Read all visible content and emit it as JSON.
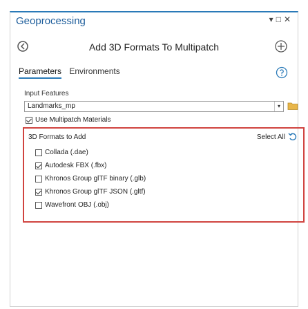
{
  "window": {
    "title": "Geoprocessing",
    "controls": [
      "▾",
      "□",
      "✕"
    ]
  },
  "tool": {
    "title": "Add 3D Formats To Multipatch"
  },
  "tabs": [
    {
      "label": "Parameters",
      "active": true
    },
    {
      "label": "Environments",
      "active": false
    }
  ],
  "input_features": {
    "label": "Input Features",
    "value": "Landmarks_mp"
  },
  "use_multipatch": {
    "label": "Use Multipatch Materials",
    "checked": true
  },
  "formats": {
    "label": "3D Formats to Add",
    "select_all": "Select All",
    "items": [
      {
        "label": "Collada (.dae)",
        "checked": false
      },
      {
        "label": "Autodesk FBX (.fbx)",
        "checked": true
      },
      {
        "label": "Khronos Group glTF binary (.glb)",
        "checked": false
      },
      {
        "label": "Khronos Group glTF JSON (.gltf)",
        "checked": true
      },
      {
        "label": "Wavefront OBJ (.obj)",
        "checked": false
      }
    ]
  },
  "colors": {
    "accent": "#2a7ab8",
    "highlight_border": "#d0433f"
  }
}
